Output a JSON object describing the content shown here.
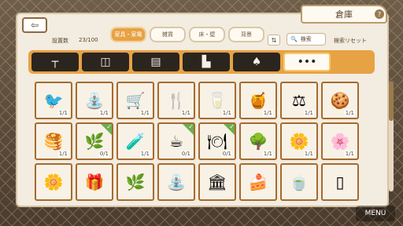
{
  "header": {
    "title": "倉庫",
    "help": "?",
    "back_icon": "back-arrow-icon",
    "count_label": "設置数",
    "count_value": "23/100",
    "categories": [
      {
        "label": "家具・家電",
        "active": true
      },
      {
        "label": "雑貨",
        "active": false
      },
      {
        "label": "床・壁",
        "active": false
      },
      {
        "label": "背景",
        "active": false
      }
    ],
    "sort_icon": "sort-icon",
    "search_label": "検索",
    "reset_label": "検索リセット"
  },
  "types": [
    {
      "icon": "table-icon",
      "glyph": "┬",
      "active": false
    },
    {
      "icon": "sofa-icon",
      "glyph": "◫",
      "active": false
    },
    {
      "icon": "cabinet-icon",
      "glyph": "▤",
      "active": false
    },
    {
      "icon": "bed-icon",
      "glyph": "▙",
      "active": false
    },
    {
      "icon": "lamp-icon",
      "glyph": "♠",
      "active": false
    },
    {
      "icon": "more-icon",
      "glyph": "•••",
      "active": true
    }
  ],
  "items": [
    {
      "icon": "bird-stand-icon",
      "glyph": "🐦",
      "qty": "1/1",
      "checked": false
    },
    {
      "icon": "fountain-icon",
      "glyph": "⛲",
      "qty": "1/1",
      "checked": false
    },
    {
      "icon": "market-stall-icon",
      "glyph": "🛒",
      "qty": "1/1",
      "checked": false
    },
    {
      "icon": "utensils-icon",
      "glyph": "🍴",
      "qty": "1/1",
      "checked": false
    },
    {
      "icon": "milk-carton-icon",
      "glyph": "🥛",
      "qty": "1/1",
      "checked": false
    },
    {
      "icon": "honey-icon",
      "glyph": "🍯",
      "qty": "1/1",
      "checked": false
    },
    {
      "icon": "scale-icon",
      "glyph": "⚖",
      "qty": "1/1",
      "checked": false
    },
    {
      "icon": "cookies-icon",
      "glyph": "🍪",
      "qty": "1/1",
      "checked": false
    },
    {
      "icon": "pancake-icon",
      "glyph": "🥞",
      "qty": "1/1",
      "checked": false
    },
    {
      "icon": "plant-icon",
      "glyph": "🌿",
      "qty": "0/1",
      "checked": true
    },
    {
      "icon": "bottle-icon",
      "glyph": "🧪",
      "qty": "1/1",
      "checked": false
    },
    {
      "icon": "coffee-grinder-icon",
      "glyph": "☕",
      "qty": "0/1",
      "checked": true
    },
    {
      "icon": "cafe-table-icon",
      "glyph": "🍽",
      "qty": "0/1",
      "checked": true
    },
    {
      "icon": "tree-icon",
      "glyph": "🌳",
      "qty": "1/1",
      "checked": false
    },
    {
      "icon": "hedge-icon",
      "glyph": "🌼",
      "qty": "1/1",
      "checked": false
    },
    {
      "icon": "blue-flowers-icon",
      "glyph": "🌸",
      "qty": "1/1",
      "checked": false
    },
    {
      "icon": "flowerbed-icon",
      "glyph": "🌼",
      "qty": "",
      "checked": false
    },
    {
      "icon": "gift-box-icon",
      "glyph": "🎁",
      "qty": "",
      "checked": false
    },
    {
      "icon": "arch-icon",
      "glyph": "🌿",
      "qty": "",
      "checked": false
    },
    {
      "icon": "fountain2-icon",
      "glyph": "⛲",
      "qty": "",
      "checked": false
    },
    {
      "icon": "arch2-icon",
      "glyph": "🏛",
      "qty": "",
      "checked": false
    },
    {
      "icon": "cake-icon",
      "glyph": "🍰",
      "qty": "",
      "checked": false
    },
    {
      "icon": "tea-set-icon",
      "glyph": "🍵",
      "qty": "",
      "checked": false
    },
    {
      "icon": "curtain-icon",
      "glyph": "▯",
      "qty": "",
      "checked": false
    }
  ],
  "menu_label": "MENU"
}
